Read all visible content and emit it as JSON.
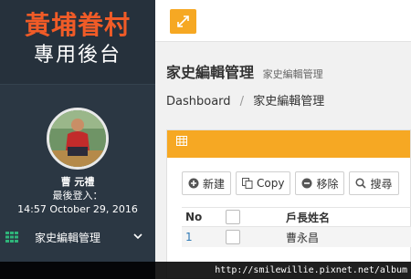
{
  "sidebar": {
    "brand_title": "黃埔眷村",
    "brand_subtitle": "專用後台",
    "user_name": "曹 元禮",
    "last_login_label": "最後登入：",
    "last_login_time": "14:57 October 29, 2016",
    "nav_item_label": "家史編輯管理"
  },
  "header": {
    "title": "家史編輯管理",
    "subtitle": "家史編輯管理"
  },
  "breadcrumb": {
    "home": "Dashboard",
    "separator": "/",
    "current": "家史編輯管理"
  },
  "toolbar": {
    "new_label": "新建",
    "copy_label": "Copy",
    "remove_label": "移除",
    "search_label": "搜尋"
  },
  "table": {
    "headers": [
      "No",
      "",
      "戶長姓名"
    ],
    "rows": [
      {
        "no": "1",
        "name": "曹永昌"
      }
    ]
  },
  "watermark": "http://smilewillie.pixnet.net/album",
  "colors": {
    "accent": "#f6a823",
    "brand": "#f05b27",
    "sidebar_bg": "#2b3743",
    "link": "#2f7ab5"
  }
}
